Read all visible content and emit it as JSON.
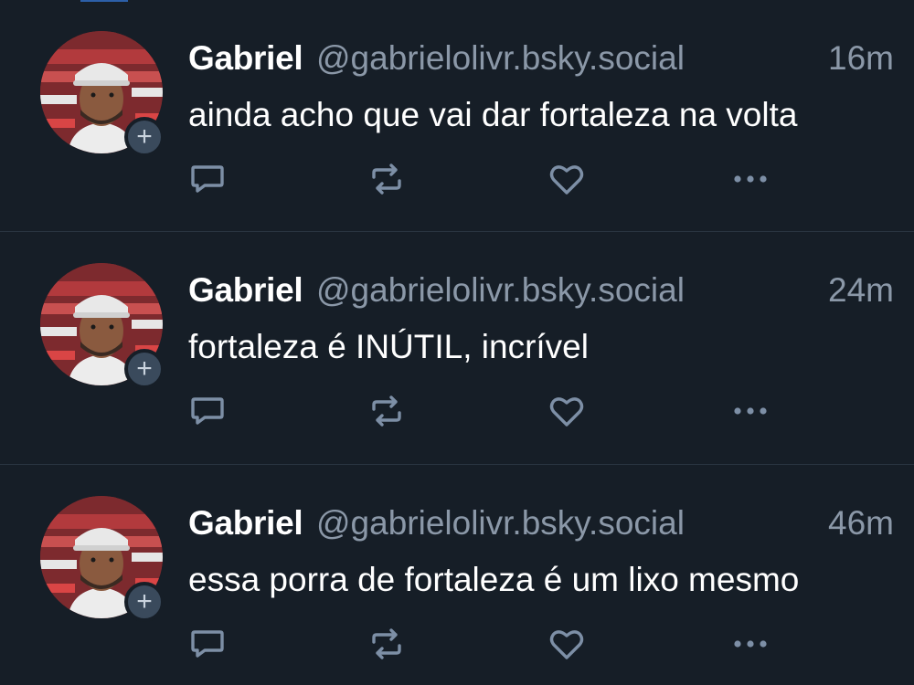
{
  "colors": {
    "background": "#161e27",
    "divider": "#2a3541",
    "name": "#ffffff",
    "meta": "#8b98a8",
    "icon": "#7d8fa6",
    "badge": "#3a4a5c"
  },
  "posts": [
    {
      "author_name": "Gabriel",
      "author_handle": "@gabrielolivr.bsky.social",
      "timestamp": "16m",
      "text": "ainda acho que vai dar fortaleza na volta",
      "follow_badge": "+",
      "icons": [
        "reply-icon",
        "repost-icon",
        "like-icon",
        "more-icon"
      ]
    },
    {
      "author_name": "Gabriel",
      "author_handle": "@gabrielolivr.bsky.social",
      "timestamp": "24m",
      "text": "fortaleza é INÚTIL, incrível",
      "follow_badge": "+",
      "icons": [
        "reply-icon",
        "repost-icon",
        "like-icon",
        "more-icon"
      ]
    },
    {
      "author_name": "Gabriel",
      "author_handle": "@gabrielolivr.bsky.social",
      "timestamp": "46m",
      "text": "essa porra de fortaleza é um lixo mesmo",
      "follow_badge": "+",
      "icons": [
        "reply-icon",
        "repost-icon",
        "like-icon",
        "more-icon"
      ]
    }
  ]
}
